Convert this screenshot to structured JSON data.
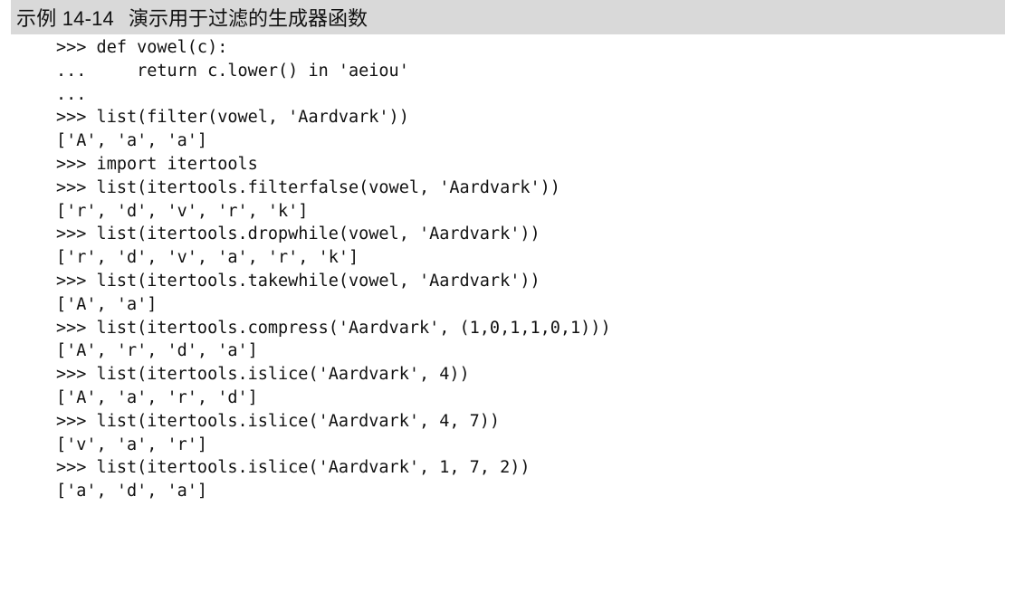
{
  "header": {
    "label": "示例 14-14",
    "title": "演示用于过滤的生成器函数"
  },
  "code_lines": [
    ">>> def vowel(c):",
    "...     return c.lower() in 'aeiou'",
    "...",
    ">>> list(filter(vowel, 'Aardvark'))",
    "['A', 'a', 'a']",
    ">>> import itertools",
    ">>> list(itertools.filterfalse(vowel, 'Aardvark'))",
    "['r', 'd', 'v', 'r', 'k']",
    ">>> list(itertools.dropwhile(vowel, 'Aardvark'))",
    "['r', 'd', 'v', 'a', 'r', 'k']",
    ">>> list(itertools.takewhile(vowel, 'Aardvark'))",
    "['A', 'a']",
    ">>> list(itertools.compress('Aardvark', (1,0,1,1,0,1)))",
    "['A', 'r', 'd', 'a']",
    ">>> list(itertools.islice('Aardvark', 4))",
    "['A', 'a', 'r', 'd']",
    ">>> list(itertools.islice('Aardvark', 4, 7))",
    "['v', 'a', 'r']",
    ">>> list(itertools.islice('Aardvark', 1, 7, 2))",
    "['a', 'd', 'a']"
  ]
}
